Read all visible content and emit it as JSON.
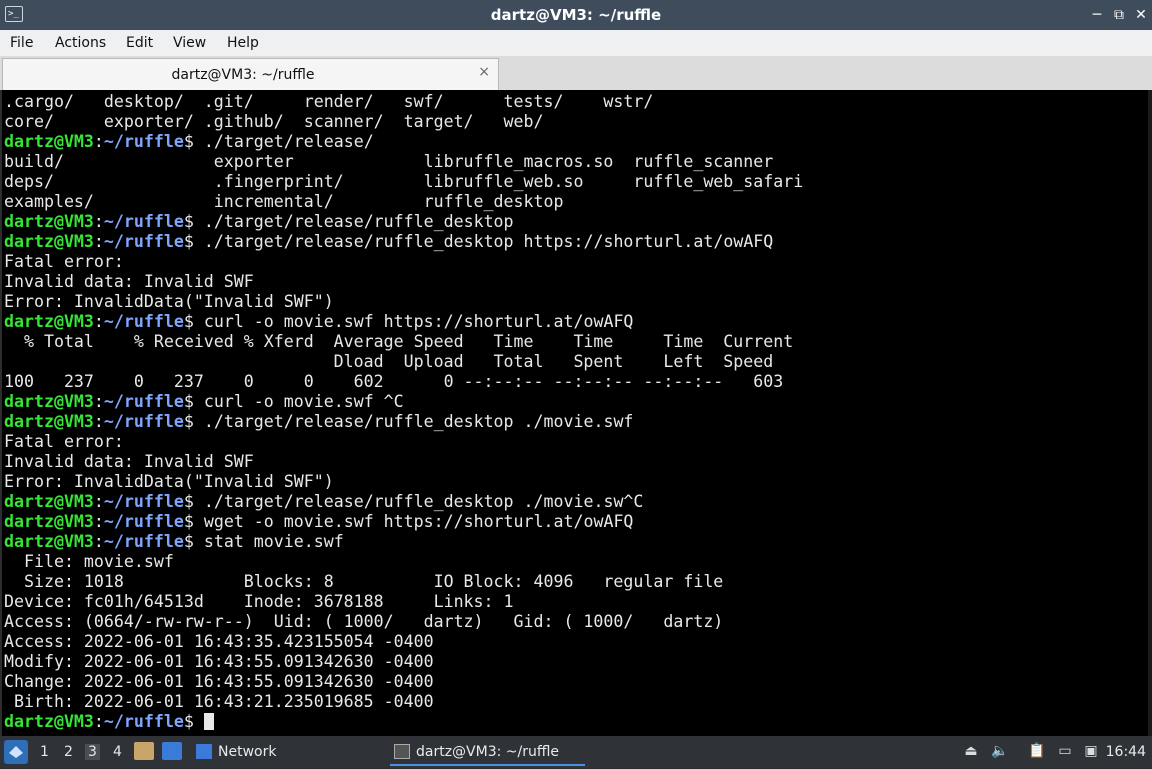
{
  "window": {
    "title": "dartz@VM3: ~/ruffle",
    "app_icon": ">_",
    "buttons": {
      "minimize": "─",
      "maximize": "⤢",
      "restore": "⧉",
      "close": "✕"
    }
  },
  "menubar": [
    "File",
    "Actions",
    "Edit",
    "View",
    "Help"
  ],
  "tab": {
    "label": "dartz@VM3: ~/ruffle",
    "close": "×"
  },
  "colors": {
    "prompt_user": "#34e534",
    "prompt_path": "#7ea6ff",
    "terminal_bg": "#000000",
    "text": "#e8e8e8"
  },
  "terminal": {
    "lines": [
      {
        "t": "out",
        "text": ".cargo/   desktop/  .git/     render/   swf/      tests/    wstr/"
      },
      {
        "t": "out",
        "text": "core/     exporter/ .github/  scanner/  target/   web/"
      },
      {
        "t": "cmd",
        "user": "dartz@VM3",
        "sep": ":",
        "path": "~/ruffle",
        "sym": "$ ",
        "cmd": "./target/release/"
      },
      {
        "t": "out",
        "text": "build/               exporter             libruffle_macros.so  ruffle_scanner"
      },
      {
        "t": "out",
        "text": "deps/                .fingerprint/        libruffle_web.so     ruffle_web_safari"
      },
      {
        "t": "out",
        "text": "examples/            incremental/         ruffle_desktop"
      },
      {
        "t": "cmd",
        "user": "dartz@VM3",
        "sep": ":",
        "path": "~/ruffle",
        "sym": "$ ",
        "cmd": "./target/release/ruffle_desktop"
      },
      {
        "t": "cmd",
        "user": "dartz@VM3",
        "sep": ":",
        "path": "~/ruffle",
        "sym": "$ ",
        "cmd": "./target/release/ruffle_desktop https://shorturl.at/owAFQ"
      },
      {
        "t": "out",
        "text": "Fatal error:"
      },
      {
        "t": "out",
        "text": "Invalid data: Invalid SWF"
      },
      {
        "t": "out",
        "text": "Error: InvalidData(\"Invalid SWF\")"
      },
      {
        "t": "cmd",
        "user": "dartz@VM3",
        "sep": ":",
        "path": "~/ruffle",
        "sym": "$ ",
        "cmd": "curl -o movie.swf https://shorturl.at/owAFQ"
      },
      {
        "t": "out",
        "text": "  % Total    % Received % Xferd  Average Speed   Time    Time     Time  Current"
      },
      {
        "t": "out",
        "text": "                                 Dload  Upload   Total   Spent    Left  Speed"
      },
      {
        "t": "out",
        "text": "100   237    0   237    0     0    602      0 --:--:-- --:--:-- --:--:--   603"
      },
      {
        "t": "cmd",
        "user": "dartz@VM3",
        "sep": ":",
        "path": "~/ruffle",
        "sym": "$ ",
        "cmd": "curl -o movie.swf ^C"
      },
      {
        "t": "cmd",
        "user": "dartz@VM3",
        "sep": ":",
        "path": "~/ruffle",
        "sym": "$ ",
        "cmd": "./target/release/ruffle_desktop ./movie.swf"
      },
      {
        "t": "out",
        "text": "Fatal error:"
      },
      {
        "t": "out",
        "text": "Invalid data: Invalid SWF"
      },
      {
        "t": "out",
        "text": "Error: InvalidData(\"Invalid SWF\")"
      },
      {
        "t": "cmd",
        "user": "dartz@VM3",
        "sep": ":",
        "path": "~/ruffle",
        "sym": "$ ",
        "cmd": "./target/release/ruffle_desktop ./movie.sw^C"
      },
      {
        "t": "cmd",
        "user": "dartz@VM3",
        "sep": ":",
        "path": "~/ruffle",
        "sym": "$ ",
        "cmd": "wget -o movie.swf https://shorturl.at/owAFQ"
      },
      {
        "t": "cmd",
        "user": "dartz@VM3",
        "sep": ":",
        "path": "~/ruffle",
        "sym": "$ ",
        "cmd": "stat movie.swf"
      },
      {
        "t": "out",
        "text": "  File: movie.swf"
      },
      {
        "t": "out",
        "text": "  Size: 1018            Blocks: 8          IO Block: 4096   regular file"
      },
      {
        "t": "out",
        "text": "Device: fc01h/64513d    Inode: 3678188     Links: 1"
      },
      {
        "t": "out",
        "text": "Access: (0664/-rw-rw-r--)  Uid: ( 1000/   dartz)   Gid: ( 1000/   dartz)"
      },
      {
        "t": "out",
        "text": "Access: 2022-06-01 16:43:35.423155054 -0400"
      },
      {
        "t": "out",
        "text": "Modify: 2022-06-01 16:43:55.091342630 -0400"
      },
      {
        "t": "out",
        "text": "Change: 2022-06-01 16:43:55.091342630 -0400"
      },
      {
        "t": "out",
        "text": " Birth: 2022-06-01 16:43:21.235019685 -0400"
      },
      {
        "t": "cmd",
        "user": "dartz@VM3",
        "sep": ":",
        "path": "~/ruffle",
        "sym": "$ ",
        "cmd": "",
        "cursor": true
      }
    ]
  },
  "taskbar": {
    "workspaces": [
      "1",
      "2",
      "3",
      "4"
    ],
    "active_workspace": "3",
    "tasks": [
      {
        "icon": "folder-icon",
        "label": "Network"
      },
      {
        "icon": "terminal-icon",
        "label": "dartz@VM3: ~/ruffle"
      }
    ],
    "tray_icons": [
      "eject-icon",
      "volume-icon",
      "clipboard-icon",
      "network-icon",
      "screen-icon"
    ],
    "clock": "16:44"
  }
}
